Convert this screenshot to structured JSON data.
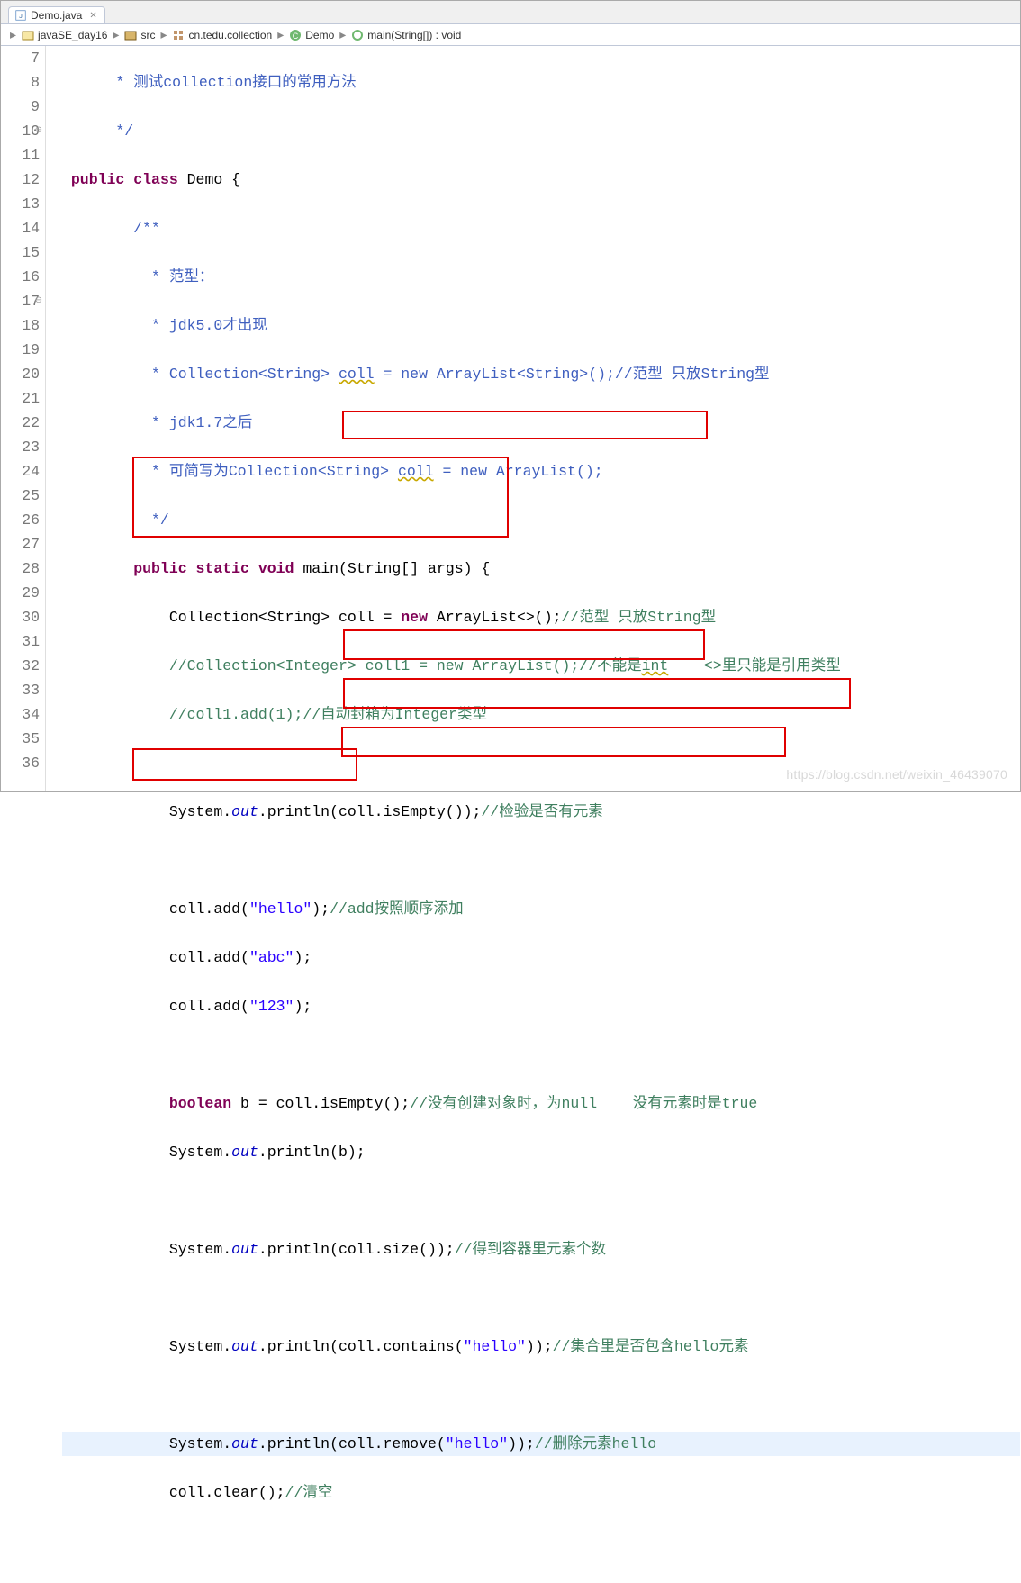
{
  "tab": {
    "filename": "Demo.java"
  },
  "breadcrumb": {
    "project": "javaSE_day16",
    "src": "src",
    "pkg": "cn.tedu.collection",
    "cls": "Demo",
    "method": "main(String[]) : void"
  },
  "lines": {
    "start": 7,
    "end": 36
  },
  "code": {
    "l7": "      * 测试collection接口的常用方法",
    "l8": "      */",
    "l9a": "public",
    "l9b": "class",
    "l9c": "Demo {",
    "l10": "        /**",
    "l11": "          * 范型：",
    "l12": "          * jdk5.0才出现",
    "l13a": "          * Collection<String> ",
    "l13b": "coll",
    "l13c": " = new ArrayList<String>();",
    "l13d": "//范型 只放String型",
    "l14": "          * jdk1.7之后",
    "l15a": "          * 可简写为Collection<String> ",
    "l15b": "coll",
    "l15c": " = new ArrayList();",
    "l16": "          */",
    "l17a": "public",
    "l17b": "static",
    "l17c": "void",
    "l17d": "main(String[] args) {",
    "l18a": "            Collection<String> coll = ",
    "l18b": "new",
    "l18c": " ArrayList<>();",
    "l18d": "//范型 只放String型",
    "l19a": "            ",
    "l19b": "//Collection<Integer> coll1 = new ArrayList();//不能是",
    "l19c": "int",
    "l19d": "    <>里只能是引用类型",
    "l20": "            //coll1.add(1);//自动封箱为Integer类型",
    "l22a": "            System.",
    "l22b": "out",
    "l22c": ".println(coll.isEmpty());",
    "l22d": "//检验是否有元素",
    "l24a": "            coll.add(",
    "l24b": "\"hello\"",
    "l24c": ");",
    "l24d": "//add按照顺序添加",
    "l25a": "            coll.add(",
    "l25b": "\"abc\"",
    "l25c": ");",
    "l26a": "            coll.add(",
    "l26b": "\"123\"",
    "l26c": ");",
    "l28a": "            ",
    "l28b": "boolean",
    "l28c": " b = coll.isEmpty();",
    "l28d": "//没有创建对象时，为null    没有元素时是true",
    "l29a": "            System.",
    "l29b": "out",
    "l29c": ".println(b);",
    "l31a": "            System.",
    "l31b": "out",
    "l31c": ".println(coll.size());",
    "l31d": "//得到容器里元素个数",
    "l33a": "            System.",
    "l33b": "out",
    "l33c": ".println(coll.contains(",
    "l33d": "\"hello\"",
    "l33e": "));",
    "l33f": "//集合里是否包含hello元素",
    "l35a": "            System.",
    "l35b": "out",
    "l35c": ".println(coll.remove(",
    "l35d": "\"hello\"",
    "l35e": "));",
    "l35f": "//删除元素hello",
    "l36a": "            coll.clear();",
    "l36b": "//清空"
  },
  "watermark": "https://blog.csdn.net/weixin_46439070"
}
